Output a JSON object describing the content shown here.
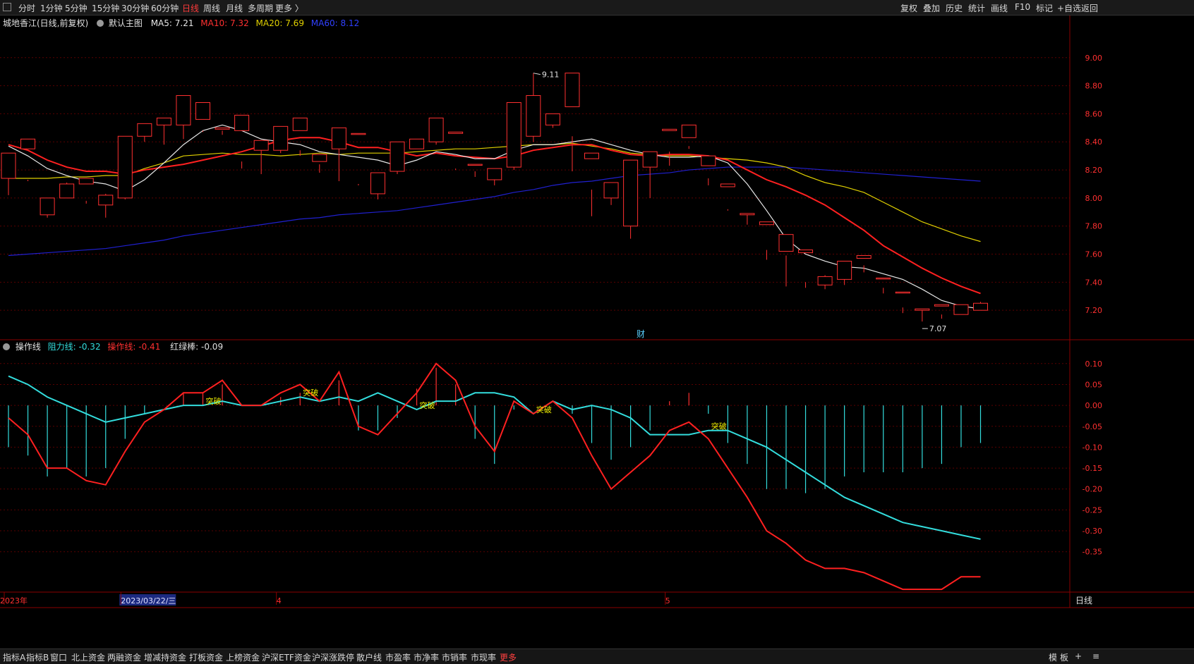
{
  "toolbar": {
    "periods": [
      "分时",
      "1分钟",
      "5分钟",
      "15分钟",
      "30分钟",
      "60分钟",
      "日线",
      "周线",
      "月线",
      "多周期",
      "更多 〉"
    ],
    "active_period": "日线",
    "right": [
      "复权",
      "叠加",
      "历史",
      "统计",
      "画线",
      "F10",
      "标记",
      "+自选",
      "返回"
    ]
  },
  "main_legend": {
    "stock": "城地香江(日线,前复权)",
    "template": "默认主图",
    "ma5": "MA5: 7.21",
    "ma10": "MA10: 7.32",
    "ma20": "MA20: 7.69",
    "ma60": "MA60: 8.12"
  },
  "sub_legend": {
    "name": "操作线",
    "resist": "阻力线: -0.32",
    "oper": "操作线: -0.41",
    "redgreen": "红绿棒: -0.09"
  },
  "colors": {
    "up": "#ff3030",
    "down": "#00f0f0",
    "ma5": "#e8e8e8",
    "ma10": "#ff2020",
    "ma20": "#e0d000",
    "ma60": "#2020d0",
    "resist": "#33dddd",
    "oper": "#ff2020",
    "grid": "#5a0000",
    "axis_text": "#ff3030"
  },
  "chart_data": [
    {
      "type": "candlestick",
      "series_ohlc": [
        [
          8.14,
          8.32,
          8.31,
          8.02
        ],
        [
          8.35,
          8.42,
          8.13,
          8.12
        ],
        [
          7.88,
          8.0,
          7.98,
          7.86
        ],
        [
          8.0,
          8.1,
          8.11,
          8.0
        ],
        [
          8.1,
          8.14,
          7.98,
          7.96
        ],
        [
          7.95,
          8.02,
          8.03,
          7.86
        ],
        [
          8.0,
          8.44,
          8.4,
          7.99
        ],
        [
          8.44,
          8.53,
          8.49,
          8.4
        ],
        [
          8.52,
          8.57,
          8.54,
          8.38
        ],
        [
          8.52,
          8.73,
          8.62,
          8.42
        ],
        [
          8.56,
          8.68,
          8.48,
          8.47
        ],
        [
          8.49,
          8.5,
          8.48,
          8.45
        ],
        [
          8.48,
          8.59,
          8.26,
          8.21
        ],
        [
          8.34,
          8.41,
          8.37,
          8.17
        ],
        [
          8.34,
          8.51,
          8.49,
          8.32
        ],
        [
          8.48,
          8.57,
          8.34,
          8.3
        ],
        [
          8.26,
          8.31,
          8.24,
          8.18
        ],
        [
          8.35,
          8.5,
          8.46,
          8.12
        ],
        [
          8.46,
          8.46,
          8.1,
          8.09
        ],
        [
          8.03,
          8.18,
          8.18,
          7.99
        ],
        [
          8.19,
          8.4,
          8.39,
          8.17
        ],
        [
          8.35,
          8.42,
          8.39,
          8.35
        ],
        [
          8.4,
          8.57,
          8.52,
          8.38
        ],
        [
          8.46,
          8.47,
          8.21,
          8.2
        ],
        [
          8.24,
          8.24,
          8.19,
          8.15
        ],
        [
          8.13,
          8.21,
          8.2,
          8.09
        ],
        [
          8.22,
          8.68,
          8.63,
          8.2
        ],
        [
          8.44,
          8.73,
          8.89,
          8.4
        ],
        [
          8.52,
          8.6,
          8.55,
          8.5
        ],
        [
          8.65,
          8.89,
          8.44,
          8.19
        ],
        [
          8.28,
          8.32,
          8.06,
          7.87
        ],
        [
          8.0,
          8.11,
          8.01,
          7.95
        ],
        [
          7.8,
          8.27,
          8.27,
          7.71
        ],
        [
          8.22,
          8.33,
          8.32,
          8.0
        ],
        [
          8.48,
          8.49,
          8.33,
          8.23
        ],
        [
          8.43,
          8.52,
          8.35,
          8.37
        ],
        [
          8.23,
          8.3,
          8.14,
          8.09
        ],
        [
          8.08,
          8.1,
          7.92,
          7.91
        ],
        [
          7.88,
          7.89,
          7.88,
          7.81
        ],
        [
          7.81,
          7.83,
          7.63,
          7.56
        ],
        [
          7.62,
          7.74,
          7.59,
          7.37
        ],
        [
          7.61,
          7.63,
          7.4,
          7.36
        ],
        [
          7.38,
          7.44,
          7.45,
          7.35
        ],
        [
          7.42,
          7.55,
          7.53,
          7.38
        ],
        [
          7.57,
          7.59,
          7.52,
          7.47
        ],
        [
          7.43,
          7.43,
          7.36,
          7.32
        ],
        [
          7.33,
          7.33,
          7.22,
          7.18
        ],
        [
          7.2,
          7.21,
          7.2,
          7.12
        ],
        [
          7.23,
          7.24,
          7.17,
          7.14
        ],
        [
          7.17,
          7.24,
          7.24,
          7.17
        ],
        [
          7.2,
          7.25,
          7.26,
          7.21
        ]
      ],
      "ohlc_order": "open,close,high,low (approximate)",
      "ma5": [
        8.37,
        8.3,
        8.21,
        8.16,
        8.12,
        8.1,
        8.05,
        8.13,
        8.25,
        8.38,
        8.48,
        8.52,
        8.48,
        8.42,
        8.4,
        8.38,
        8.33,
        8.31,
        8.29,
        8.27,
        8.23,
        8.27,
        8.33,
        8.31,
        8.28,
        8.28,
        8.34,
        8.38,
        8.38,
        8.4,
        8.42,
        8.38,
        8.34,
        8.31,
        8.29,
        8.29,
        8.3,
        8.25,
        8.1,
        7.91,
        7.71,
        7.6,
        7.55,
        7.51,
        7.5,
        7.46,
        7.42,
        7.35,
        7.27,
        7.23,
        7.21
      ],
      "ma10": [
        8.38,
        8.34,
        8.27,
        8.22,
        8.19,
        8.19,
        8.17,
        8.2,
        8.22,
        8.24,
        8.27,
        8.3,
        8.33,
        8.37,
        8.41,
        8.43,
        8.43,
        8.4,
        8.36,
        8.36,
        8.33,
        8.3,
        8.32,
        8.3,
        8.29,
        8.28,
        8.3,
        8.34,
        8.36,
        8.38,
        8.38,
        8.34,
        8.31,
        8.3,
        8.31,
        8.31,
        8.3,
        8.27,
        8.2,
        8.13,
        8.08,
        8.02,
        7.95,
        7.86,
        7.77,
        7.66,
        7.58,
        7.5,
        7.43,
        7.37,
        7.32
      ],
      "ma20": [
        8.14,
        8.14,
        8.14,
        8.15,
        8.15,
        8.16,
        8.16,
        8.21,
        8.25,
        8.3,
        8.31,
        8.32,
        8.31,
        8.31,
        8.3,
        8.31,
        8.32,
        8.31,
        8.32,
        8.32,
        8.32,
        8.33,
        8.34,
        8.35,
        8.35,
        8.36,
        8.37,
        8.38,
        8.38,
        8.39,
        8.37,
        8.35,
        8.32,
        8.31,
        8.3,
        8.3,
        8.29,
        8.28,
        8.27,
        8.25,
        8.22,
        8.16,
        8.11,
        8.08,
        8.04,
        7.97,
        7.9,
        7.83,
        7.78,
        7.73,
        7.69
      ],
      "ma60": [
        7.59,
        7.6,
        7.61,
        7.62,
        7.63,
        7.64,
        7.66,
        7.68,
        7.7,
        7.73,
        7.75,
        7.77,
        7.79,
        7.81,
        7.83,
        7.85,
        7.86,
        7.88,
        7.89,
        7.9,
        7.91,
        7.93,
        7.95,
        7.97,
        7.99,
        8.01,
        8.04,
        8.06,
        8.09,
        8.11,
        8.12,
        8.14,
        8.16,
        8.17,
        8.18,
        8.2,
        8.21,
        8.22,
        8.22,
        8.22,
        8.22,
        8.21,
        8.2,
        8.19,
        8.18,
        8.17,
        8.16,
        8.15,
        8.14,
        8.13,
        8.12
      ],
      "yticks": [
        "9.00",
        "8.80",
        "8.60",
        "8.40",
        "8.20",
        "8.00",
        "7.80",
        "7.60",
        "7.40",
        "7.20"
      ],
      "ylim": [
        7.0,
        9.25
      ],
      "annotations": {
        "high": "9.11",
        "low": "7.07",
        "marker": "财"
      }
    },
    {
      "type": "line+bar",
      "resist": [
        0.07,
        0.05,
        0.02,
        0.0,
        -0.02,
        -0.04,
        -0.03,
        -0.02,
        -0.01,
        0.0,
        0.0,
        0.01,
        0.0,
        0.0,
        0.01,
        0.02,
        0.01,
        0.02,
        0.01,
        0.03,
        0.01,
        -0.01,
        0.01,
        0.01,
        0.03,
        0.03,
        0.02,
        -0.02,
        0.01,
        -0.01,
        0.0,
        -0.01,
        -0.03,
        -0.07,
        -0.07,
        -0.07,
        -0.06,
        -0.06,
        -0.08,
        -0.1,
        -0.13,
        -0.16,
        -0.19,
        -0.22,
        -0.24,
        -0.26,
        -0.28,
        -0.29,
        -0.3,
        -0.31,
        -0.32
      ],
      "oper": [
        -0.03,
        -0.07,
        -0.15,
        -0.15,
        -0.18,
        -0.19,
        -0.11,
        -0.04,
        -0.01,
        0.03,
        0.03,
        0.06,
        0.0,
        0.0,
        0.03,
        0.05,
        0.01,
        0.08,
        -0.05,
        -0.07,
        -0.02,
        0.03,
        0.1,
        0.06,
        -0.05,
        -0.11,
        0.01,
        -0.02,
        0.01,
        -0.03,
        -0.12,
        -0.2,
        -0.16,
        -0.12,
        -0.06,
        -0.04,
        -0.08,
        -0.15,
        -0.22,
        -0.3,
        -0.33,
        -0.37,
        -0.39,
        -0.39,
        -0.4,
        -0.42,
        -0.44,
        -0.44,
        -0.44,
        -0.41,
        -0.41
      ],
      "bars": [
        -0.1,
        -0.12,
        -0.17,
        -0.15,
        -0.17,
        -0.15,
        -0.08,
        -0.02,
        0.0,
        0.03,
        0.03,
        0.05,
        0.0,
        0.0,
        0.02,
        0.03,
        0.0,
        0.06,
        -0.06,
        -0.06,
        -0.03,
        0.04,
        0.09,
        0.05,
        -0.08,
        -0.14,
        -0.01,
        0.0,
        0.0,
        -0.02,
        -0.09,
        -0.13,
        -0.1,
        -0.06,
        0.01,
        0.03,
        -0.02,
        -0.09,
        -0.14,
        -0.2,
        -0.2,
        -0.21,
        -0.2,
        -0.17,
        -0.16,
        -0.16,
        -0.16,
        -0.15,
        -0.14,
        -0.1,
        -0.09
      ],
      "breakouts": [
        {
          "i": 10,
          "label": "突破"
        },
        {
          "i": 15,
          "label": "突破"
        },
        {
          "i": 21,
          "label": "突破"
        },
        {
          "i": 27,
          "label": "突破"
        },
        {
          "i": 36,
          "label": "突破"
        }
      ],
      "yticks": [
        "0.10",
        "0.05",
        "0.00",
        "-0.05",
        "-0.10",
        "-0.15",
        "-0.20",
        "-0.25",
        "-0.30",
        "-0.35"
      ],
      "ylim": [
        -0.45,
        0.13
      ]
    }
  ],
  "xaxis": {
    "labels": [
      {
        "i": 0,
        "text": "2023年"
      },
      {
        "i": 6,
        "text": "2023/03/22/三"
      },
      {
        "i": 14,
        "text": "4"
      },
      {
        "i": 34,
        "text": "5"
      }
    ],
    "period_label": "日线"
  },
  "bottombar": {
    "items": [
      "指标A",
      "指标B",
      "窗口",
      "北上资金",
      "两融资金",
      "增减持资金",
      "打板资金",
      "上榜资金",
      "沪深ETF资金",
      "沪深涨跌停",
      "散户线",
      "市盈率",
      "市净率",
      "市销率",
      "市现率",
      "更多"
    ],
    "right": [
      "模",
      "板",
      "+",
      "≡"
    ]
  }
}
